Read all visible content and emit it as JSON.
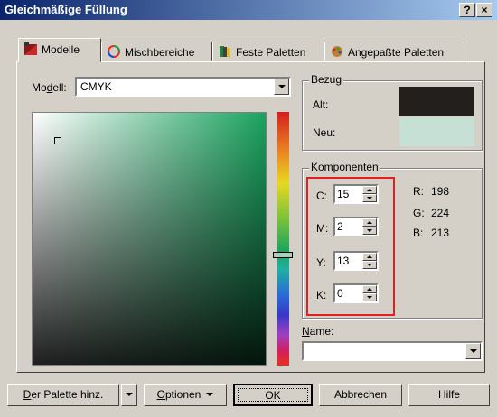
{
  "window": {
    "title": "Gleichmäßige Füllung",
    "help_btn": "?",
    "close_btn": "×"
  },
  "tabs": [
    {
      "label": "Modelle",
      "icon": "models-icon",
      "active": true
    },
    {
      "label": "Mischbereiche",
      "icon": "mixer-icon",
      "active": false
    },
    {
      "label": "Feste Paletten",
      "icon": "fixed-palettes-icon",
      "active": false
    },
    {
      "label": "Angepaßte Paletten",
      "icon": "custom-palettes-icon",
      "active": false
    }
  ],
  "model": {
    "label_pre": "Mo",
    "label_u": "d",
    "label_post": "ell:",
    "value": "CMYK"
  },
  "reference": {
    "title": "Bezug",
    "old_label": "Alt:",
    "new_label": "Neu:",
    "old_color": "#231f1c",
    "new_color": "#c6e0d5"
  },
  "components": {
    "title": "Komponenten",
    "fields": [
      {
        "label": "C:",
        "value": "15"
      },
      {
        "label": "M:",
        "value": "2"
      },
      {
        "label": "Y:",
        "value": "13"
      },
      {
        "label": "K:",
        "value": "0"
      }
    ],
    "rgb": [
      {
        "label": "R:",
        "value": "198"
      },
      {
        "label": "G:",
        "value": "224"
      },
      {
        "label": "B:",
        "value": "213"
      }
    ]
  },
  "name": {
    "label_u": "N",
    "label_rest": "ame:",
    "value": ""
  },
  "buttons": {
    "add_palette_u": "D",
    "add_palette_rest": "er Palette hinz.",
    "options_u": "O",
    "options_rest": "ptionen",
    "ok": "OK",
    "cancel": "Abbrechen",
    "help": "Hilfe"
  },
  "colors": {
    "title_start": "#0a246a",
    "title_end": "#a6caf0",
    "highlight_box": "#e02020",
    "face": "#d4d0c8"
  }
}
